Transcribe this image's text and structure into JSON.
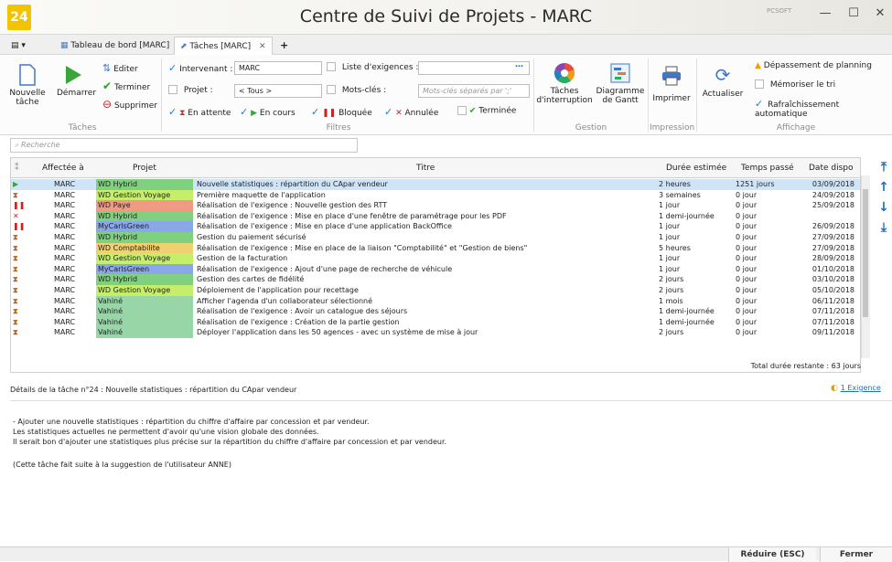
{
  "window": {
    "title": "Centre de Suivi de Projets - MARC",
    "logo": "24",
    "brand": "PCSOFT"
  },
  "tabs": [
    {
      "label": "Tableau de bord [MARC]"
    },
    {
      "label": "Tâches [MARC]"
    }
  ],
  "ribbon": {
    "taches": {
      "nouvelle": "Nouvelle\ntâche",
      "demarrer": "Démarrer",
      "editer": "Editer",
      "terminer": "Terminer",
      "supprimer": "Supprimer",
      "group": "Tâches"
    },
    "filtres": {
      "intervenant_label": "Intervenant :",
      "intervenant_value": "MARC",
      "projet_label": "Projet :",
      "projet_value": "< Tous >",
      "exigences_label": "Liste d'exigences :",
      "exigences_value": "",
      "mots_label": "Mots-clés :",
      "mots_placeholder": "Mots-clés séparés par ';'",
      "states": [
        "En attente",
        "En cours",
        "Bloquée",
        "Annulée",
        "Terminée"
      ],
      "group": "Filtres"
    },
    "gestion": {
      "interruption": "Tâches\nd'interruption",
      "gantt": "Diagramme\nde Gantt",
      "group": "Gestion"
    },
    "impression": {
      "imprimer": "Imprimer",
      "group": "Impression"
    },
    "affichage": {
      "actualiser": "Actualiser",
      "depassement": "Dépassement de planning",
      "memoriser": "Mémoriser le tri",
      "rafraichissement": "Rafraîchissement automatique",
      "group": "Affichage"
    }
  },
  "search": {
    "placeholder": "Recherche"
  },
  "grid": {
    "headers": [
      "Affectée à",
      "Projet",
      "Titre",
      "Durée estimée",
      "Temps passé",
      "Date dispo"
    ],
    "rows": [
      {
        "status": "play",
        "assignee": "MARC",
        "project": "WD Hybrid",
        "pcolor": "#7fd07f",
        "title": "Nouvelle statistiques : répartition du CApar vendeur",
        "duree": "2 heures",
        "temps": "1251 jours",
        "date": "03/09/2018",
        "selected": true
      },
      {
        "status": "hourglass",
        "assignee": "MARC",
        "project": "WD Gestion Voyage",
        "pcolor": "#c5ef6a",
        "title": "Première maquette de l'application",
        "duree": "3 semaines",
        "temps": "0 jour",
        "date": "24/09/2018"
      },
      {
        "status": "blocked",
        "assignee": "MARC",
        "project": "WD Paye",
        "pcolor": "#ef9a82",
        "title": "Réalisation de l'exigence : Nouvelle gestion des RTT",
        "duree": "1 jour",
        "temps": "0 jour",
        "date": "25/09/2018"
      },
      {
        "status": "cancel",
        "assignee": "MARC",
        "project": "WD Hybrid",
        "pcolor": "#7fd07f",
        "title": "Réalisation de l'exigence : Mise en place d'une fenêtre de paramétrage pour les PDF",
        "duree": "1 demi-journée",
        "temps": "0 jour",
        "date": ""
      },
      {
        "status": "blocked",
        "assignee": "MARC",
        "project": "MyCarlsGreen",
        "pcolor": "#8aa7e8",
        "title": "Réalisation de l'exigence : Mise en place d'une application BackOffice",
        "duree": "1 jour",
        "temps": "0 jour",
        "date": "26/09/2018"
      },
      {
        "status": "hourglass",
        "assignee": "MARC",
        "project": "WD Hybrid",
        "pcolor": "#7fd07f",
        "title": "Gestion du paiement sécurisé",
        "duree": "1 jour",
        "temps": "0 jour",
        "date": "27/09/2018"
      },
      {
        "status": "hourglass",
        "assignee": "MARC",
        "project": "WD Comptabilite",
        "pcolor": "#f0d070",
        "title": "Réalisation de l'exigence : Mise en place de la liaison \"Comptabilité\" et \"Gestion de biens\"",
        "duree": "5 heures",
        "temps": "0 jour",
        "date": "27/09/2018"
      },
      {
        "status": "hourglass",
        "assignee": "MARC",
        "project": "WD Gestion Voyage",
        "pcolor": "#c5ef6a",
        "title": "Gestion de la facturation",
        "duree": "1 jour",
        "temps": "0 jour",
        "date": "28/09/2018"
      },
      {
        "status": "hourglass",
        "assignee": "MARC",
        "project": "MyCarlsGreen",
        "pcolor": "#8aa7e8",
        "title": "Réalisation de l'exigence : Ajout d'une page de recherche de véhicule",
        "duree": "1 jour",
        "temps": "0 jour",
        "date": "01/10/2018"
      },
      {
        "status": "hourglass",
        "assignee": "MARC",
        "project": "WD Hybrid",
        "pcolor": "#7fd07f",
        "title": "Gestion des cartes de fidélité",
        "duree": "2 jours",
        "temps": "0 jour",
        "date": "03/10/2018"
      },
      {
        "status": "hourglass",
        "assignee": "MARC",
        "project": "WD Gestion Voyage",
        "pcolor": "#c5ef6a",
        "title": "Déploiement de l'application pour recettage",
        "duree": "2 jours",
        "temps": "0 jour",
        "date": "05/10/2018"
      },
      {
        "status": "hourglass",
        "assignee": "MARC",
        "project": "Vahiné",
        "pcolor": "#98d6a8",
        "title": "Afficher l'agenda d'un collaborateur sélectionné",
        "duree": "1 mois",
        "temps": "0 jour",
        "date": "06/11/2018"
      },
      {
        "status": "hourglass",
        "assignee": "MARC",
        "project": "Vahiné",
        "pcolor": "#98d6a8",
        "title": "Réalisation de l'exigence : Avoir un catalogue des séjours",
        "duree": "1 demi-journée",
        "temps": "0 jour",
        "date": "07/11/2018"
      },
      {
        "status": "hourglass",
        "assignee": "MARC",
        "project": "Vahiné",
        "pcolor": "#98d6a8",
        "title": "Réalisation de l'exigence : Création de la partie gestion",
        "duree": "1 demi-journée",
        "temps": "0 jour",
        "date": "07/11/2018"
      },
      {
        "status": "hourglass",
        "assignee": "MARC",
        "project": "Vahiné",
        "pcolor": "#98d6a8",
        "title": "Déployer l'application dans les 50 agences - avec un système de mise à jour",
        "duree": "2 jours",
        "temps": "0 jour",
        "date": "09/11/2018"
      }
    ],
    "total": "Total durée restante : 63 jours"
  },
  "detail": {
    "title": "Détails de la tâche n°24 : Nouvelle statistiques : répartition du CApar vendeur",
    "exigence_link": "1 Exigence",
    "lines": [
      "- Ajouter une nouvelle statistiques : répartition du chiffre d'affaire par concession et par vendeur.",
      "Les statistiques actuelles ne permettent d'avoir qu'une vision globale des données.",
      "Il serait bon d'ajouter une statistiques plus précise sur la répartition du chiffre d'affaire par concession et par vendeur.",
      "",
      "(Cette tâche fait suite à la suggestion de l'utilisateur ANNE)"
    ]
  },
  "footer": {
    "reduire": "Réduire (ESC)",
    "fermer": "Fermer"
  },
  "colors": {
    "accent": "#1d7ad9",
    "selected_row": "#cfe5f7"
  }
}
